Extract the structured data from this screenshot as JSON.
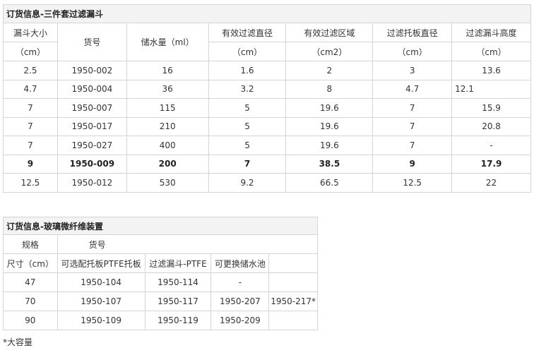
{
  "table1": {
    "caption": "订货信息-三件套过滤漏斗",
    "headers": [
      [
        "漏斗大小",
        "（cm）"
      ],
      [
        "货号"
      ],
      [
        "储水量（ml）"
      ],
      [
        "有效过滤直径",
        "（cm）"
      ],
      [
        "有效过滤区域",
        "（cm2）"
      ],
      [
        "过滤托板直径",
        "（cm）"
      ],
      [
        "过滤漏斗高度",
        "（cm）"
      ]
    ],
    "rows": [
      [
        "2.5",
        "1950-002",
        "16",
        "1.6",
        "2",
        "3",
        "13.6"
      ],
      [
        "4.7",
        "1950-004",
        "36",
        "3.2",
        "8",
        "4.7",
        "12.1"
      ],
      [
        "7",
        "1950-007",
        "115",
        "5",
        "19.6",
        "7",
        "15.9"
      ],
      [
        "7",
        "1950-017",
        "210",
        "5",
        "19.6",
        "7",
        "20.8"
      ],
      [
        "7",
        "1950-027",
        "400",
        "5",
        "19.6",
        "7",
        "-"
      ],
      [
        "9",
        "1950-009",
        "200",
        "7",
        "38.5",
        "9",
        "17.9"
      ],
      [
        "12.5",
        "1950-012",
        "530",
        "9.2",
        "66.5",
        "12.5",
        "22"
      ]
    ]
  },
  "table2": {
    "caption": "订货信息-玻璃微纤维装置",
    "header_row1": [
      "规格",
      "货号"
    ],
    "header_row2": [
      "尺寸（cm）",
      "可选配托板PTFE托板",
      "过滤漏斗-PTFE",
      "可更换储水池"
    ],
    "rows": [
      [
        "47",
        "1950-104",
        "1950-114",
        "-",
        ""
      ],
      [
        "70",
        "1950-107",
        "1950-117",
        "1950-207",
        "1950-217*"
      ],
      [
        "90",
        "1950-109",
        "1950-119",
        "1950-209",
        ""
      ]
    ]
  },
  "footnote": "*大容量"
}
